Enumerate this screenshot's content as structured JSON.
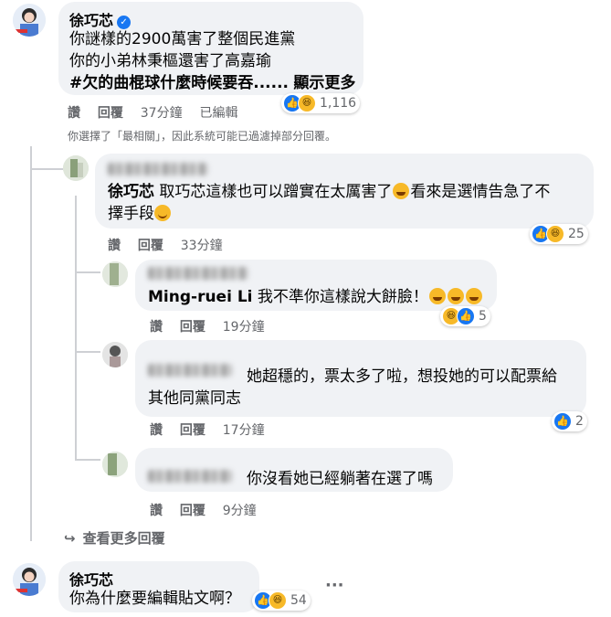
{
  "comments": [
    {
      "author": "徐巧芯",
      "lines": [
        "你謎樣的2900萬害了整個民進黨",
        "你的小弟林秉樞還害了高嘉瑜",
        "#欠的曲棍球什麼時候要吞......"
      ],
      "see_more": "顯示更多",
      "reaction_count": "1,116",
      "actions": {
        "like": "讚",
        "reply": "回覆",
        "time": "37分鐘",
        "edited": "已編輯"
      }
    }
  ],
  "filter_notice": "你選擇了「最相關」，因此系統可能已過濾掉部分回覆。",
  "replies": [
    {
      "mention": "徐巧芯",
      "text_a": "取巧芯這樣也可以蹭實在太厲害了",
      "text_b": "看來是選情告急了不",
      "text_c": "擇手段",
      "reaction_count": "25",
      "actions": {
        "like": "讚",
        "reply": "回覆",
        "time": "33分鐘"
      }
    },
    {
      "mention": "Ming-ruei Li",
      "text": "我不準你這樣說大餅臉！",
      "reaction_count": "5",
      "actions": {
        "like": "讚",
        "reply": "回覆",
        "time": "19分鐘"
      }
    },
    {
      "text_a": "她超穩的，票太多了啦，想投她的可以配票給",
      "text_b": "其他同黨同志",
      "reaction_count": "2",
      "actions": {
        "like": "讚",
        "reply": "回覆",
        "time": "17分鐘"
      }
    },
    {
      "text": "你沒看她已經躺著在選了嗎",
      "actions": {
        "like": "讚",
        "reply": "回覆",
        "time": "9分鐘"
      }
    }
  ],
  "view_more_replies": "查看更多回覆",
  "last_comment": {
    "author": "徐巧芯",
    "text": "你為什麼要編輯貼文啊？",
    "reaction_count": "54",
    "more_label": "···"
  },
  "colors": {
    "like_blue": "#1877f2",
    "haha_yellow": "#f7b928",
    "bubble_gray": "#f0f2f5",
    "meta_gray": "#65676b"
  },
  "icons": [
    "verified-badge-icon",
    "like-reaction-icon",
    "haha-reaction-icon",
    "reply-arrow-icon",
    "more-options-icon"
  ]
}
